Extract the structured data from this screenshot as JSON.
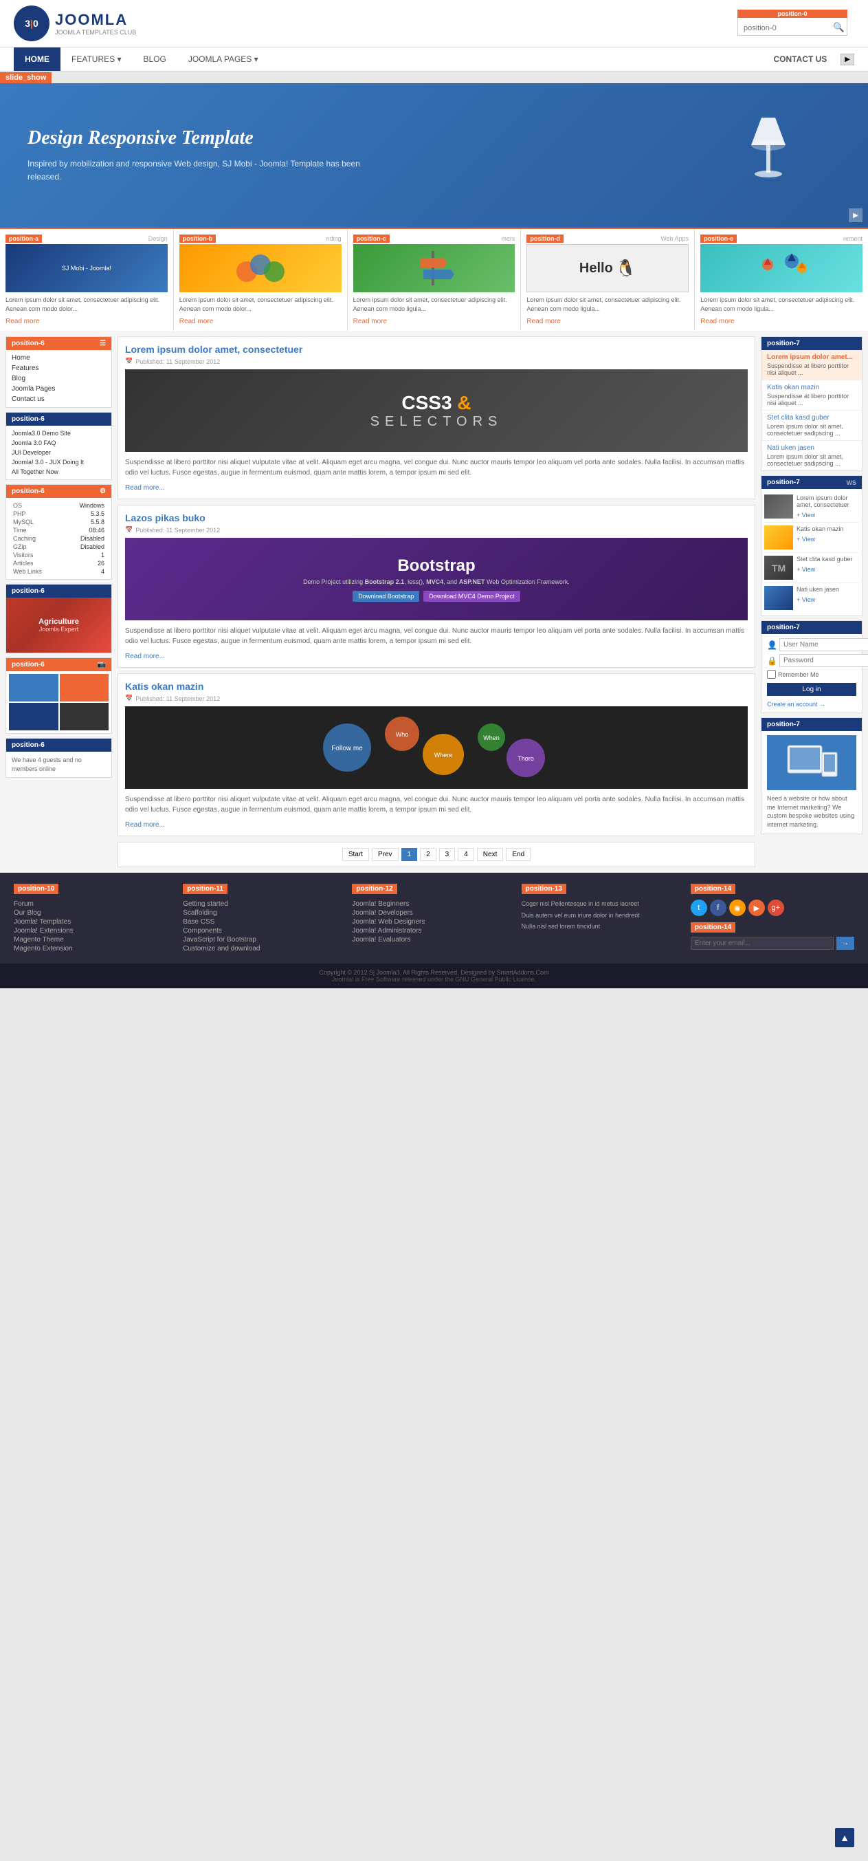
{
  "header": {
    "logo_text": "JOOMLA",
    "logo_subtitle": "JOOMLA TEMPLATES CLUB",
    "logo_numbers": "3|0",
    "search_placeholder": "position-0",
    "nav": [
      {
        "label": "HOME",
        "active": true
      },
      {
        "label": "FEATURES ▾",
        "active": false
      },
      {
        "label": "BLOG",
        "active": false
      },
      {
        "label": "JOOMLA PAGES ▾",
        "active": false
      },
      {
        "label": "CONTACT US",
        "active": false
      }
    ]
  },
  "slideshow": {
    "label": "slide_show",
    "title": "Design Responsive Template",
    "description": "Inspired by mobilization and responsive Web design, SJ Mobi - Joomla! Template has been released."
  },
  "positions_row": [
    {
      "label": "position-a",
      "title": "Design",
      "text": "Lorem ipsum dolor sit amet, consectetuer adipiscing elit. Aenean com modo dolor...",
      "read_more": "Read more",
      "img_color": "#1a3a7a"
    },
    {
      "label": "position-b",
      "title": "nding",
      "text": "Lorem ipsum dolor sit amet, consectetuer adipiscing elit. Aenean com modo dolor...",
      "read_more": "Read more",
      "img_color": "#f90"
    },
    {
      "label": "position-c",
      "title": "mers",
      "text": "Lorem ipsum dolor sit amet, consectetuer adipiscing elit. Aenean com modo ligula...",
      "read_more": "Read more",
      "img_color": "#3a9a3a"
    },
    {
      "label": "position-d",
      "title": "Web Apps",
      "text": "Lorem ipsum dolor sit amet, consectetuer adipiscing elit. Aenean com modo ligula...",
      "read_more": "Read more",
      "img_color": "#eee"
    },
    {
      "label": "position-e",
      "title": "rement",
      "text": "Lorem ipsum dolor sit amet, consectetuer adipiscing elit. Aenean com modo ligula...",
      "read_more": "Read more",
      "img_color": "#3abfbf"
    }
  ],
  "sidebar_left": {
    "pos6_menu_label": "position-6",
    "menu_items": [
      "Home",
      "Features",
      "Blog",
      "Joomla Pages",
      "Contact us"
    ],
    "pos6_links_label": "position-6",
    "link_items": [
      "Joomla3.0 Demo Site",
      "Joomla 3.0 FAQ",
      "JUI Developer",
      "Joomla! 3.0 - JUX Doing It",
      "All Together Now"
    ],
    "pos6_sys_label": "position-6",
    "sys_data": {
      "OS": "Windows",
      "PHP": "5.3.5",
      "MySQL": "5.5.8",
      "Time": "08:46",
      "Caching": "Disabled",
      "GZip": "Disabled",
      "Visitors": "1",
      "Articles": "26",
      "Web Links": "4"
    },
    "pos6_img_label": "position-6",
    "pos6_gallery_label": "position-6",
    "pos6_guests_label": "position-6",
    "guests_text": "We have 4 guests and no members online"
  },
  "articles": [
    {
      "title": "Lorem ipsum dolor amet, consectetuer",
      "published": "Published: 11 September 2012",
      "type": "css3",
      "text": "Suspendisse at libero porttitor nisi aliquet vulputate vitae at velit. Aliquam eget arcu magna, vel congue dui. Nunc auctor mauris tempor leo aliquam vel porta ante sodales. Nulla facilisi. In accumsan mattis odio vel luctus. Fusce egestas, augue in fermentum euismod, quam ante mattis lorem, a tempor ipsum mi sed elit.",
      "read_more": "Read more..."
    },
    {
      "title": "Lazos pikas buko",
      "published": "Published: 11 September 2012",
      "type": "bootstrap",
      "text": "Suspendisse at libero porttitor nisi aliquet vulputate vitae at velit. Aliquam eget arcu magna, vel congue dui. Nunc auctor mauris tempor leo aliquam vel porta ante sodales. Nulla facilisi. In accumsan mattis odio vel luctus. Fusce egestas, augue in fermentum euismod, quam ante mattis lorem, a tempor ipsum mi sed elit.",
      "read_more": "Read more...",
      "btn1": "Download Bootstrap",
      "btn2": "Download MVC4 Demo Project"
    },
    {
      "title": "Katis okan mazin",
      "published": "Published: 11 September 2012",
      "type": "katis",
      "text": "Suspendisse at libero porttitor nisi aliquet vulputate vitae at velit. Aliquam eget arcu magna, vel congue dui. Nunc auctor mauris tempor leo aliquam vel porta ante sodales. Nulla facilisi. In accumsan mattis odio vel luctus. Fusce egestas, augue in fermentum euismod, quam ante mattis lorem, a tempor ipsum mi sed elit.",
      "read_more": "Read more..."
    }
  ],
  "pagination": {
    "start": "Start",
    "prev": "Prev",
    "pages": [
      "1",
      "2",
      "3",
      "4"
    ],
    "next": "Next",
    "end": "End"
  },
  "sidebar_right": {
    "pos7_top_label": "position-7",
    "top_items": [
      {
        "title": "Lorem ipsum dolor amet...",
        "text": "Suspendisse at libero porttitor nisi aliquet ...",
        "active": true
      },
      {
        "title": "Katis okan mazin",
        "text": "Suspendisse at libero porttitor nisi aliquet ...",
        "active": false
      },
      {
        "title": "Stet clita kasd guber",
        "text": "Lorem ipsum dolor sit amet, consectetuer sadipscing ...",
        "active": false
      },
      {
        "title": "Nati uken jasen",
        "text": "Lorem ipsum dolor sit amet, consectetuer sadipscing ...",
        "active": false
      }
    ],
    "pos7_news_label": "position-7",
    "news_label": "WS",
    "news_items": [
      {
        "title": "Lorem ipsum dolor amet, consectetuer",
        "view": "+ View"
      },
      {
        "title": "Katis okan mazin",
        "view": "+ View"
      },
      {
        "title": "Stet clita kasd guber",
        "view": "+ View"
      },
      {
        "title": "Nati uken jasen",
        "view": "+ View"
      }
    ],
    "pos7_login_label": "position-7",
    "login": {
      "username_placeholder": "User Name",
      "password_placeholder": "Password",
      "remember_label": "Remember Me",
      "login_btn": "Log in",
      "create_account": "Create an account →"
    },
    "pos7_responsive_label": "position-7",
    "responsive_text": "Need a website or how about me Internet marketing? We custom bespoke websites using internet marketing."
  },
  "footer": {
    "pos10_label": "position-10",
    "pos10_items": [
      "Forum",
      "Our Blog",
      "Joomla! Templates",
      "Joomla! Extensions",
      "Magento Theme",
      "Magento Extension"
    ],
    "pos11_label": "position-11",
    "pos11_items": [
      "Getting started",
      "Scaffolding",
      "Base CSS",
      "Components",
      "JavaScript for Bootstrap",
      "Customize and download"
    ],
    "pos12_label": "position-12",
    "pos12_items": [
      "Joomla! Beginners",
      "Joomla! Developers",
      "Joomla! Web Designers",
      "Joomla! Administrators",
      "Joomla! Evaluators"
    ],
    "pos13_label": "position-13",
    "pos13_text1": "Coger nisl Pellentesque in id metus iaoreet",
    "pos13_text2": "Duis autem vel eum iriure dolor in hendrerit",
    "pos13_text3": "Nulla nisl sed lorem tincidunt",
    "pos14_label": "position-14",
    "pos14_label2": "position-14",
    "footer_email_placeholder": "Enter your email...",
    "copyright": "Copyright © 2012 Sj Joomla3. All Rights Reserved. Designed by SmartAddons.Com",
    "copyright2": "Joomla! is Free Software released under the GNU General Public License."
  }
}
